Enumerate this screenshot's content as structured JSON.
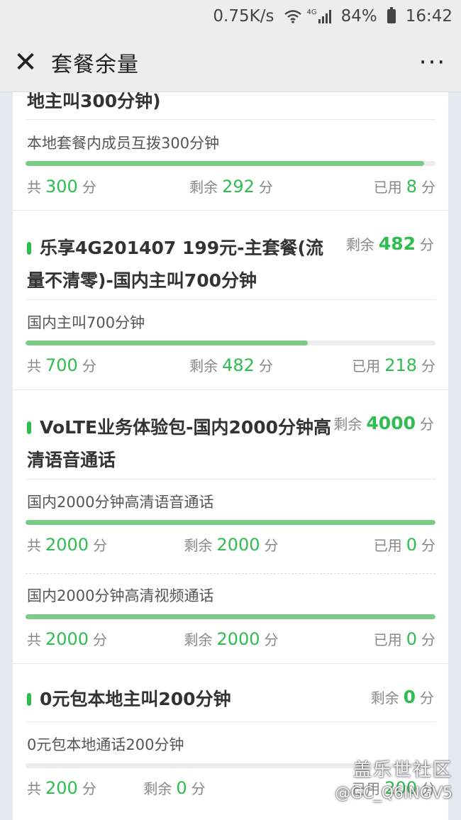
{
  "status_bar": {
    "speed": "0.75K/s",
    "net": "4G",
    "battery": "84%",
    "time": "16:42"
  },
  "nav": {
    "close": "✕",
    "title": "套餐余量",
    "more": "···"
  },
  "labels": {
    "total": "共",
    "remain": "剩余",
    "used": "已用",
    "unit": "分"
  },
  "packages": [
    {
      "name_tail": "地主叫300分钟)",
      "items": [
        {
          "name": "本地套餐内成员互拨300分钟",
          "total": "300",
          "remain": "292",
          "used": "8",
          "fraction": 0.973
        }
      ]
    },
    {
      "name": "乐享4G201407 199元-主套餐(流量不清零)-国内主叫700分钟",
      "remain": "482",
      "items": [
        {
          "name": "国内主叫700分钟",
          "total": "700",
          "remain": "482",
          "used": "218",
          "fraction": 0.689
        }
      ]
    },
    {
      "name": "VoLTE业务体验包-国内2000分钟高清语音通话",
      "remain": "4000",
      "items": [
        {
          "name": "国内2000分钟高清语音通话",
          "total": "2000",
          "remain": "2000",
          "used": "0",
          "fraction": 1.0
        },
        {
          "name": "国内2000分钟高清视频通话",
          "total": "2000",
          "remain": "2000",
          "used": "0",
          "fraction": 1.0
        }
      ]
    },
    {
      "name": "0元包本地主叫200分钟",
      "remain": "0",
      "items": [
        {
          "name": "0元包本地通话200分钟",
          "total": "200",
          "remain": "0",
          "used": "200",
          "fraction": 0.0
        }
      ]
    }
  ],
  "watermark": {
    "brand": "盖乐世社区",
    "user": "@GC_Q6INGV5"
  },
  "colors": {
    "accent": "#2ebd4f",
    "bar_fill": "#7acb86",
    "bar_track": "#ececec"
  }
}
